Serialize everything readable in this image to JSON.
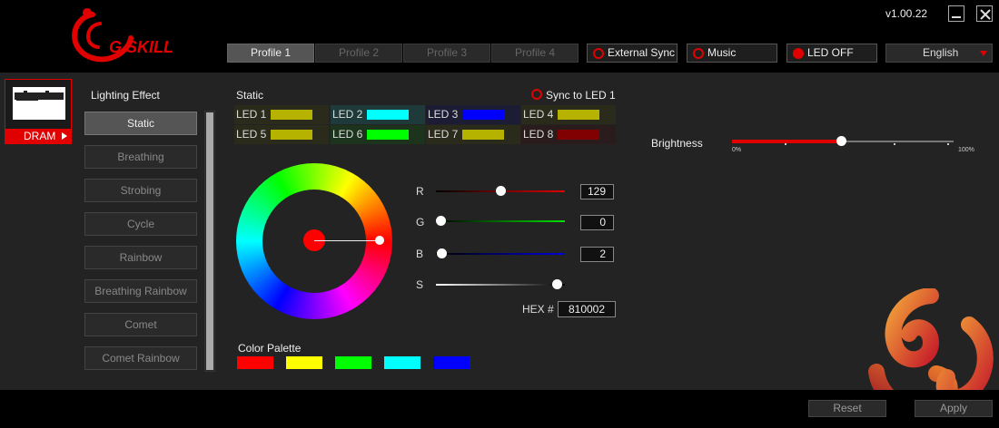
{
  "app": {
    "logo_text": "G.SKILL",
    "version": "v1.00.22"
  },
  "header": {
    "profiles": [
      "Profile 1",
      "Profile 2",
      "Profile 3",
      "Profile 4"
    ],
    "active_profile": "Profile 1",
    "external_sync": "External Sync",
    "music": "Music",
    "led_off": "LED OFF",
    "language": "English"
  },
  "device": {
    "label": "DRAM"
  },
  "lighting": {
    "title": "Lighting Effect",
    "effects": [
      "Static",
      "Breathing",
      "Strobing",
      "Cycle",
      "Rainbow",
      "Breathing Rainbow",
      "Comet",
      "Comet Rainbow"
    ],
    "active_effect": "Static"
  },
  "static": {
    "title": "Static",
    "sync_label": "Sync to LED 1",
    "leds": [
      {
        "label": "LED 1",
        "color": "#b5b300"
      },
      {
        "label": "LED 2",
        "color": "#00ffff"
      },
      {
        "label": "LED 3",
        "color": "#0000ff"
      },
      {
        "label": "LED 4",
        "color": "#b5b300"
      },
      {
        "label": "LED 5",
        "color": "#b5b300"
      },
      {
        "label": "LED 6",
        "color": "#00ff00"
      },
      {
        "label": "LED 7",
        "color": "#b5b300"
      },
      {
        "label": "LED 8",
        "color": "#810002"
      }
    ]
  },
  "color": {
    "r_label": "R",
    "r_value": "129",
    "g_label": "G",
    "g_value": "0",
    "b_label": "B",
    "b_value": "2",
    "s_label": "S",
    "hex_label": "HEX #",
    "hex_value": "810002"
  },
  "palette": {
    "title": "Color Palette",
    "colors": [
      "#ff0000",
      "#ffff00",
      "#00ff00",
      "#00ffff",
      "#0000ff"
    ]
  },
  "brightness": {
    "label": "Brightness",
    "min_label": "0%",
    "max_label": "100%",
    "level": 0.5
  },
  "footer": {
    "reset": "Reset",
    "apply": "Apply"
  },
  "theme": {
    "accent": "#e10000"
  }
}
